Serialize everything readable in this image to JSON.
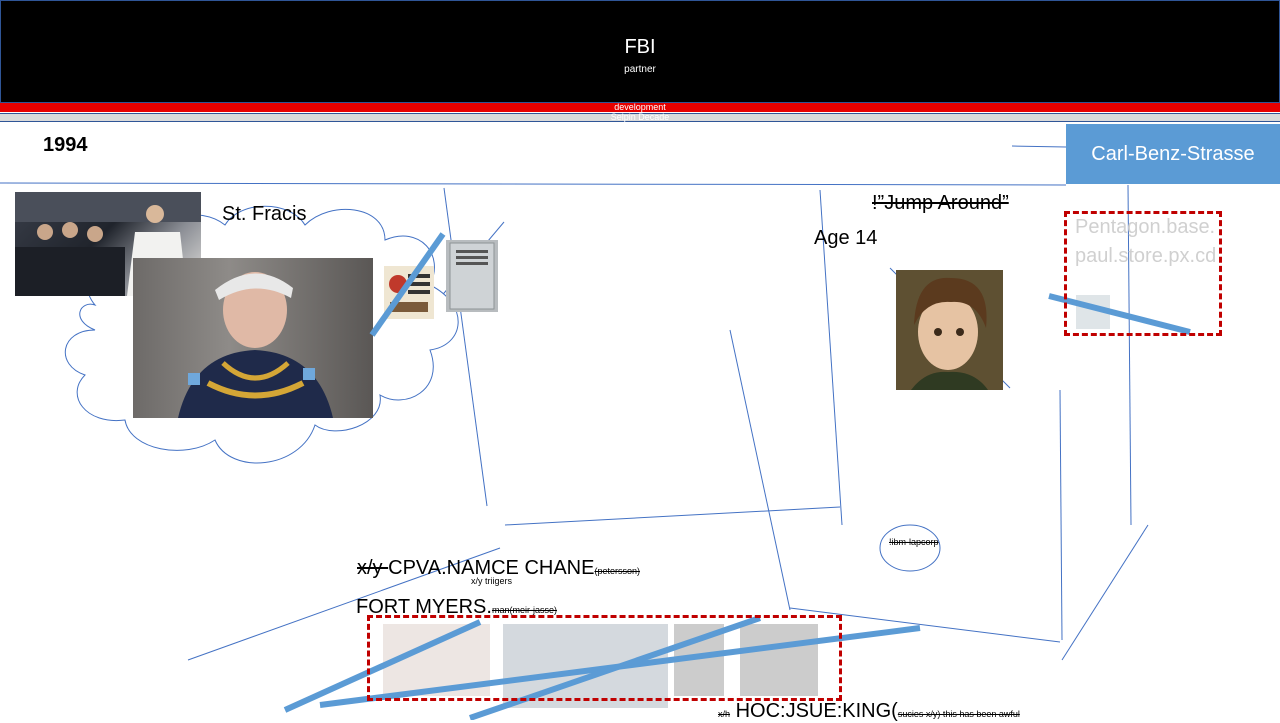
{
  "header": {
    "title": "FBI",
    "subtitle": "partner"
  },
  "bands": {
    "red_label": "development",
    "grey_label": "Selpin Decade"
  },
  "year": "1994",
  "address": "Carl-Benz-Strasse",
  "labels": {
    "saint": "St. Fracis",
    "song": "!”Jump Around”",
    "age": "Age 14",
    "pentagon": "Pentagon.base.paul.store.px.cd",
    "circle_note": "!ibm-lapcorp"
  },
  "name_line": {
    "struck_prefix": "x/y ",
    "main": "CPVA.NAMCE CHANE",
    "suffix": "(petersson)",
    "sub_note": "x/y triigers"
  },
  "city_line": {
    "main": "FORT MYERS.",
    "suffix": "man(meir-jasse)"
  },
  "bottom_line": {
    "prefix": "x/h",
    "main": "HOC:JSUE:KING(",
    "suffix": "sucies x/y) this has been awful"
  },
  "colors": {
    "header_bg": "#000000",
    "red_band": "#e60000",
    "accent_blue": "#5b9bd5",
    "line_blue": "#4472c4",
    "dashed_red": "#c00000"
  }
}
